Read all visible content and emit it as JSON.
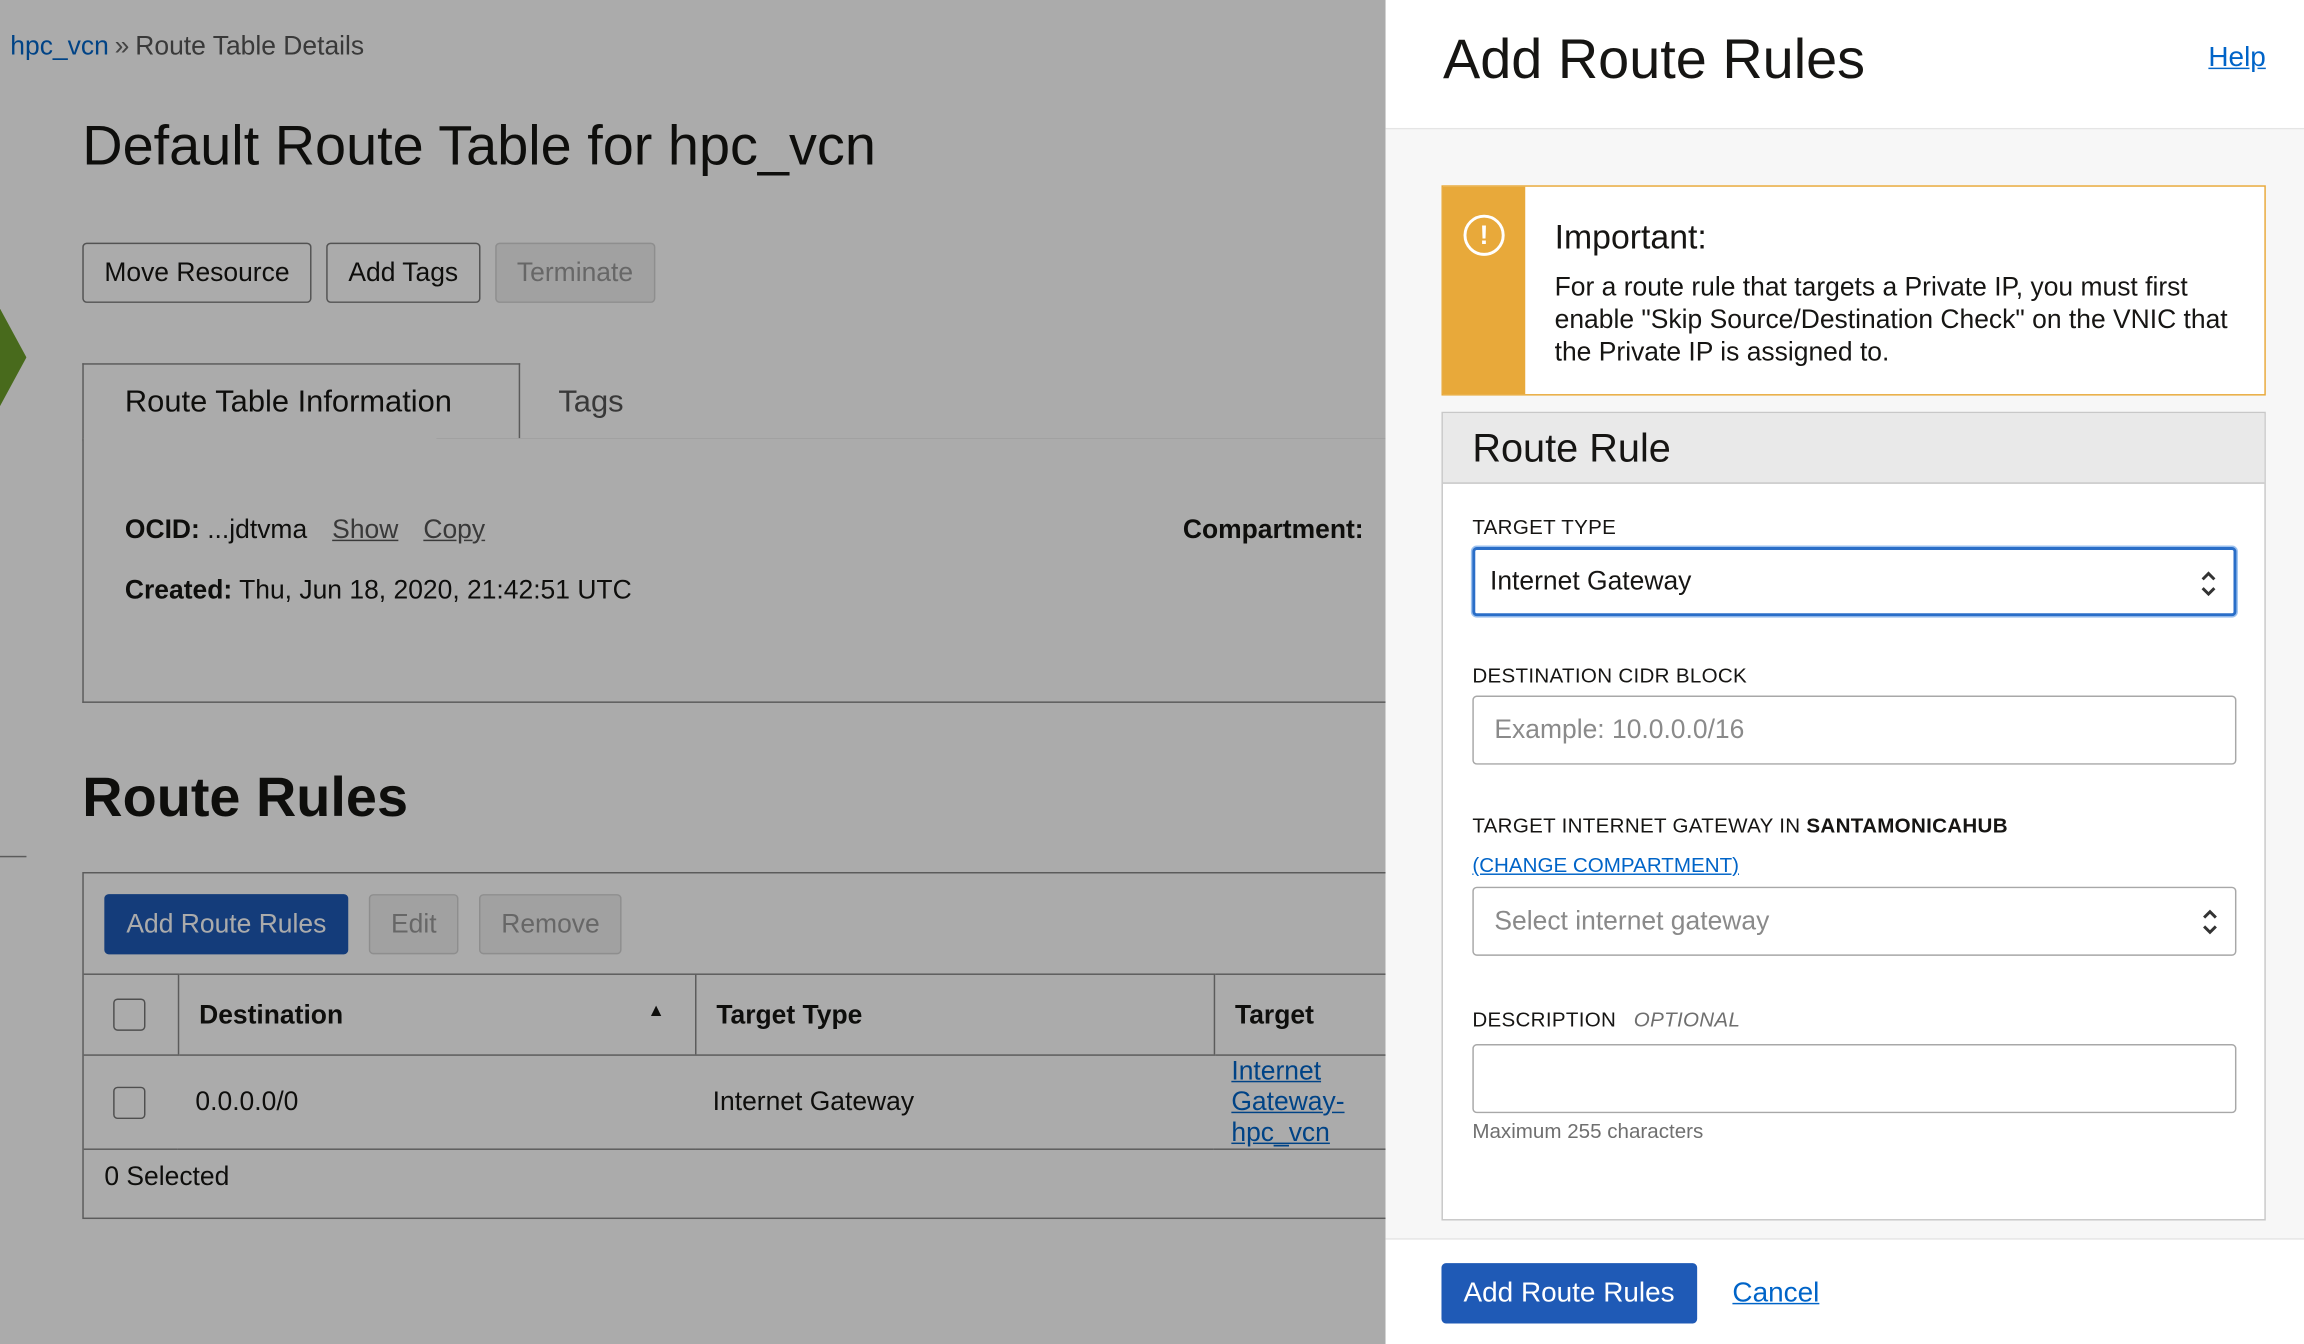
{
  "breadcrumb": {
    "link": "hpc_vcn",
    "separator": "»",
    "current": "Route Table Details"
  },
  "page": {
    "title": "Default Route Table for hpc_vcn",
    "buttons": {
      "move": "Move Resource",
      "tags": "Add Tags",
      "terminate": "Terminate"
    },
    "tabs": {
      "info": "Route Table Information",
      "tags": "Tags"
    },
    "info": {
      "ocid_label": "OCID:",
      "ocid_value": "...jdtvma",
      "show": "Show",
      "copy": "Copy",
      "created_label": "Created:",
      "created_value": "Thu, Jun 18, 2020, 21:42:51 UTC",
      "compartment_label": "Compartment:"
    },
    "route_rules": {
      "title": "Route Rules",
      "add": "Add Route Rules",
      "edit": "Edit",
      "remove": "Remove",
      "columns": {
        "destination": "Destination",
        "target_type": "Target Type",
        "target": "Target"
      },
      "rows": [
        {
          "destination": "0.0.0.0/0",
          "target_type": "Internet Gateway",
          "target": "Internet Gateway-hpc_vcn"
        }
      ],
      "selected": "0 Selected"
    }
  },
  "panel": {
    "title": "Add Route Rules",
    "help": "Help",
    "notice": {
      "title": "Important:",
      "text": "For a route rule that targets a Private IP, you must first enable \"Skip Source/Destination Check\" on the VNIC that the Private IP is assigned to.",
      "color": "#e8a93a"
    },
    "rule": {
      "title": "Route Rule",
      "target_type_label": "TARGET TYPE",
      "target_type_value": "Internet Gateway",
      "cidr_label": "DESTINATION CIDR BLOCK",
      "cidr_placeholder": "Example: 10.0.0.0/16",
      "gateway_label_prefix": "TARGET INTERNET GATEWAY IN",
      "gateway_label_compartment": "SANTAMONICAHUB",
      "change_compartment": "(CHANGE COMPARTMENT)",
      "gateway_placeholder": "Select internet gateway",
      "description_label": "DESCRIPTION",
      "description_optional": "OPTIONAL",
      "description_value": "",
      "description_helper": "Maximum 255 characters"
    },
    "footer": {
      "submit": "Add Route Rules",
      "cancel": "Cancel"
    }
  },
  "colors": {
    "primary": "#1f5ab6",
    "link": "#0064c8",
    "warning": "#e8a93a"
  }
}
